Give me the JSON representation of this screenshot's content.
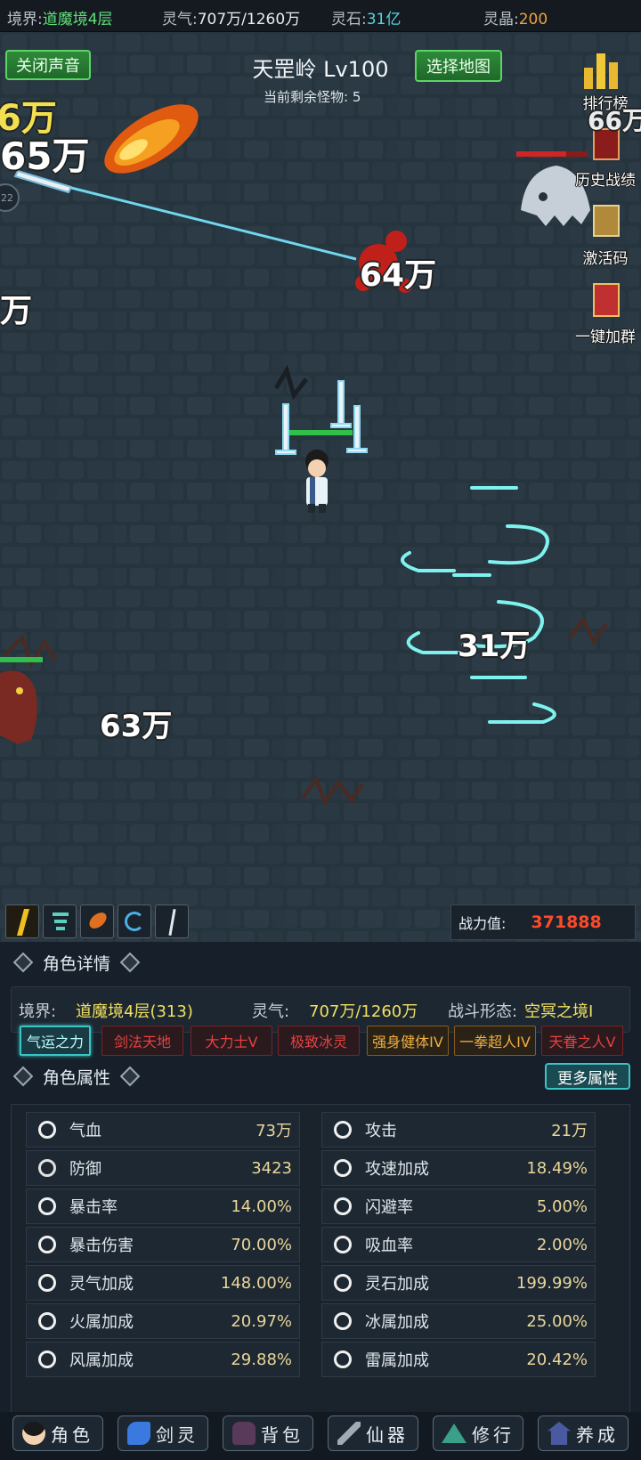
{
  "topbar": {
    "realm_label": "境界:",
    "realm_value": "道魔境4层",
    "qi_label": "灵气:",
    "qi_value": "707万/1260万",
    "stone_label": "灵石:",
    "stone_value": "31亿",
    "crystal_label": "灵晶:",
    "crystal_value": "200"
  },
  "field": {
    "sound_button": "关闭声音",
    "map_title": "天罡岭 Lv100",
    "map_button": "选择地图",
    "monster_count": "当前剩余怪物:  5",
    "ranking": "排行榜",
    "history": "历史战绩",
    "activation": "激活码",
    "join_group": "一键加群",
    "damage_numbers": [
      "6万",
      "65万",
      "64万",
      "万",
      "31万",
      "63万",
      "66万"
    ],
    "orb_number": "22",
    "power_label": "战力值:",
    "power_value": "371888",
    "skill_icons": [
      "lightning-skill-icon",
      "tornado-skill-icon",
      "fireball-skill-icon",
      "whirlwind-skill-icon",
      "sword-skill-icon"
    ]
  },
  "details": {
    "title": "角色详情",
    "realm_label": "境界:",
    "realm_value": "道魔境4层(313)",
    "qi_label": "灵气:",
    "qi_value": "707万/1260万",
    "form_label": "战斗形态:",
    "form_value": "空冥之境I",
    "tags": [
      "气运之力",
      "剑法天地",
      "大力士V",
      "极致冰灵",
      "强身健体IV",
      "一拳超人IV",
      "天眷之人V"
    ]
  },
  "attributes": {
    "title": "角色属性",
    "more_button": "更多属性",
    "left": [
      {
        "name": "气血",
        "value": "73万",
        "icon": "heart-icon"
      },
      {
        "name": "防御",
        "value": "3423",
        "icon": "armor-icon"
      },
      {
        "name": "暴击率",
        "value": "14.00%",
        "icon": "crit-icon"
      },
      {
        "name": "暴击伤害",
        "value": "70.00%",
        "icon": "crit-damage-icon"
      },
      {
        "name": "灵气加成",
        "value": "148.00%",
        "icon": "qi-icon"
      },
      {
        "name": "火属加成",
        "value": "20.97%",
        "icon": "fire-icon"
      },
      {
        "name": "风属加成",
        "value": "29.88%",
        "icon": "wind-icon"
      }
    ],
    "right": [
      {
        "name": "攻击",
        "value": "21万",
        "icon": "sword-icon"
      },
      {
        "name": "攻速加成",
        "value": "18.49%",
        "icon": "attack-speed-icon"
      },
      {
        "name": "闪避率",
        "value": "5.00%",
        "icon": "dodge-icon"
      },
      {
        "name": "吸血率",
        "value": "2.00%",
        "icon": "lifesteal-icon"
      },
      {
        "name": "灵石加成",
        "value": "199.99%",
        "icon": "spirit-stone-icon"
      },
      {
        "name": "冰属加成",
        "value": "25.00%",
        "icon": "ice-icon"
      },
      {
        "name": "雷属加成",
        "value": "20.42%",
        "icon": "thunder-icon"
      }
    ]
  },
  "nav": [
    {
      "label": "角色",
      "icon": "character-icon"
    },
    {
      "label": "剑灵",
      "icon": "sword-spirit-icon"
    },
    {
      "label": "背包",
      "icon": "bag-icon"
    },
    {
      "label": "仙器",
      "icon": "artifact-icon"
    },
    {
      "label": "修行",
      "icon": "cultivation-icon"
    },
    {
      "label": "养成",
      "icon": "training-icon"
    }
  ]
}
